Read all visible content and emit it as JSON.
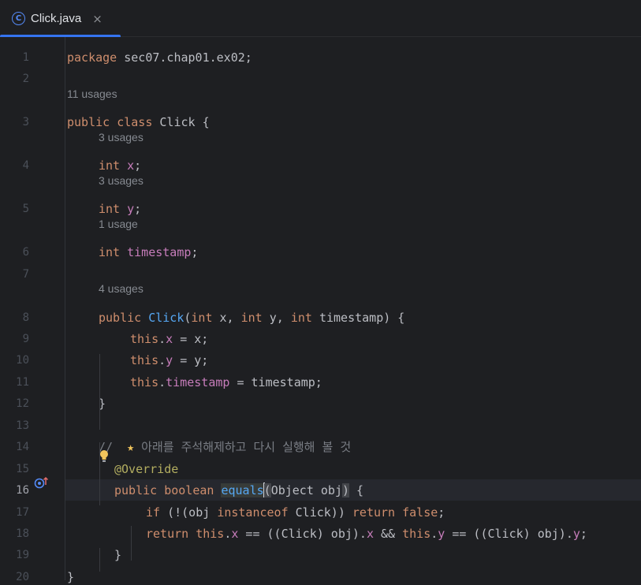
{
  "tab": {
    "icon_letter": "C",
    "file_name": "Click.java",
    "close_glyph": "×"
  },
  "colors": {
    "accent": "#3574f0",
    "keyword": "#cf8e6d",
    "field": "#c77dbb",
    "method": "#56a8f5",
    "annotation": "#b3ae60"
  },
  "lines": [
    {
      "n": "1",
      "code": [
        {
          "t": "package",
          "c": "kw"
        },
        {
          "t": " sec07.chap01.ex02;"
        }
      ]
    },
    {
      "n": "2",
      "code": []
    },
    {
      "n": "3",
      "usage": "11 usages",
      "code": [
        {
          "t": "public",
          "c": "kw"
        },
        {
          "t": " "
        },
        {
          "t": "class",
          "c": "kw"
        },
        {
          "t": " Click {"
        }
      ]
    },
    {
      "n": "4",
      "usage": "3 usages",
      "code": [
        {
          "t": "int",
          "c": "kw"
        },
        {
          "t": " "
        },
        {
          "t": "x",
          "c": "fld"
        },
        {
          "t": ";"
        }
      ]
    },
    {
      "n": "5",
      "usage": "3 usages",
      "code": [
        {
          "t": "int",
          "c": "kw"
        },
        {
          "t": " "
        },
        {
          "t": "y",
          "c": "fld"
        },
        {
          "t": ";"
        }
      ]
    },
    {
      "n": "6",
      "usage": "1 usage",
      "code": [
        {
          "t": "int",
          "c": "kw"
        },
        {
          "t": " "
        },
        {
          "t": "timestamp",
          "c": "fld"
        },
        {
          "t": ";"
        }
      ]
    },
    {
      "n": "7",
      "code": []
    },
    {
      "n": "8",
      "usage": "4 usages",
      "code": [
        {
          "t": "public",
          "c": "kw"
        },
        {
          "t": " "
        },
        {
          "t": "Click",
          "c": "fn"
        },
        {
          "t": "("
        },
        {
          "t": "int",
          "c": "kw"
        },
        {
          "t": " x, "
        },
        {
          "t": "int",
          "c": "kw"
        },
        {
          "t": " y, "
        },
        {
          "t": "int",
          "c": "kw"
        },
        {
          "t": " timestamp) {"
        }
      ]
    },
    {
      "n": "9",
      "code": [
        {
          "t": "this",
          "c": "kw"
        },
        {
          "t": "."
        },
        {
          "t": "x",
          "c": "fld"
        },
        {
          "t": " = x;"
        }
      ]
    },
    {
      "n": "10",
      "code": [
        {
          "t": "this",
          "c": "kw"
        },
        {
          "t": "."
        },
        {
          "t": "y",
          "c": "fld"
        },
        {
          "t": " = y;"
        }
      ]
    },
    {
      "n": "11",
      "code": [
        {
          "t": "this",
          "c": "kw"
        },
        {
          "t": "."
        },
        {
          "t": "timestamp",
          "c": "fld"
        },
        {
          "t": " = timestamp;"
        }
      ]
    },
    {
      "n": "12",
      "code": [
        {
          "t": "}"
        }
      ]
    },
    {
      "n": "13",
      "code": []
    },
    {
      "n": "14",
      "code": [
        {
          "t": "//  ",
          "c": "cmt"
        },
        {
          "t": "★",
          "c": "star-icon"
        },
        {
          "t": " 아래를 주석해제하고 다시 실행해 볼 것",
          "c": "cmt"
        }
      ]
    },
    {
      "n": "15",
      "code": [
        {
          "t": "@Override",
          "c": "ann"
        }
      ]
    },
    {
      "n": "16",
      "current": true,
      "code": [
        {
          "t": "public",
          "c": "kw"
        },
        {
          "t": " "
        },
        {
          "t": "boolean",
          "c": "kw"
        },
        {
          "t": " "
        },
        {
          "t": "equals",
          "c": "hl-method"
        },
        {
          "t": "",
          "c": "caret"
        },
        {
          "t": "(",
          "c": "paren-hl"
        },
        {
          "t": "Object obj"
        },
        {
          "t": ")",
          "c": "paren-hl"
        },
        {
          "t": " {"
        }
      ]
    },
    {
      "n": "17",
      "code": [
        {
          "t": "if",
          "c": "kw"
        },
        {
          "t": " (!(obj "
        },
        {
          "t": "instanceof",
          "c": "kw"
        },
        {
          "t": " Click)) "
        },
        {
          "t": "return",
          "c": "kw"
        },
        {
          "t": " "
        },
        {
          "t": "false",
          "c": "kw"
        },
        {
          "t": ";"
        }
      ]
    },
    {
      "n": "18",
      "code": [
        {
          "t": "return",
          "c": "kw"
        },
        {
          "t": " "
        },
        {
          "t": "this",
          "c": "kw"
        },
        {
          "t": "."
        },
        {
          "t": "x",
          "c": "fld"
        },
        {
          "t": " == ((Click) obj)."
        },
        {
          "t": "x",
          "c": "fld"
        },
        {
          "t": " && "
        },
        {
          "t": "this",
          "c": "kw"
        },
        {
          "t": "."
        },
        {
          "t": "y",
          "c": "fld"
        },
        {
          "t": " == ((Click) obj)."
        },
        {
          "t": "y",
          "c": "fld"
        },
        {
          "t": ";"
        }
      ]
    },
    {
      "n": "19",
      "code": [
        {
          "t": "}"
        }
      ]
    },
    {
      "n": "20",
      "code": [
        {
          "t": "}"
        }
      ]
    }
  ]
}
